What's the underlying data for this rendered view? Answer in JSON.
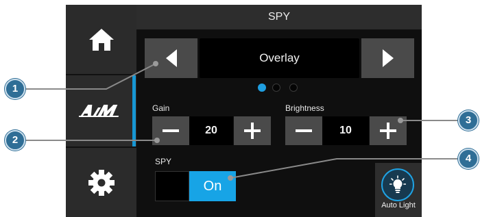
{
  "header": {
    "title": "SPY"
  },
  "sidebar": {
    "items": [
      {
        "icon": "home-icon"
      },
      {
        "icon": "aim-logo-icon",
        "logo_text": "AiM"
      },
      {
        "icon": "gear-icon"
      }
    ]
  },
  "mode_selector": {
    "value": "Overlay",
    "prev_icon": "triangle-left-icon",
    "next_icon": "triangle-right-icon",
    "page_count": 3,
    "active_page": 1
  },
  "gain": {
    "label": "Gain",
    "value": "20"
  },
  "brightness": {
    "label": "Brightness",
    "value": "10"
  },
  "spy_toggle": {
    "label": "SPY",
    "state_label": "On"
  },
  "auto_light": {
    "label": "Auto Light",
    "icon": "light-bulb-icon"
  },
  "callouts": [
    "1",
    "2",
    "3",
    "4"
  ],
  "colors": {
    "accent": "#1797d4",
    "toggle_on": "#17a4e6",
    "callout": "#2f6e96"
  }
}
